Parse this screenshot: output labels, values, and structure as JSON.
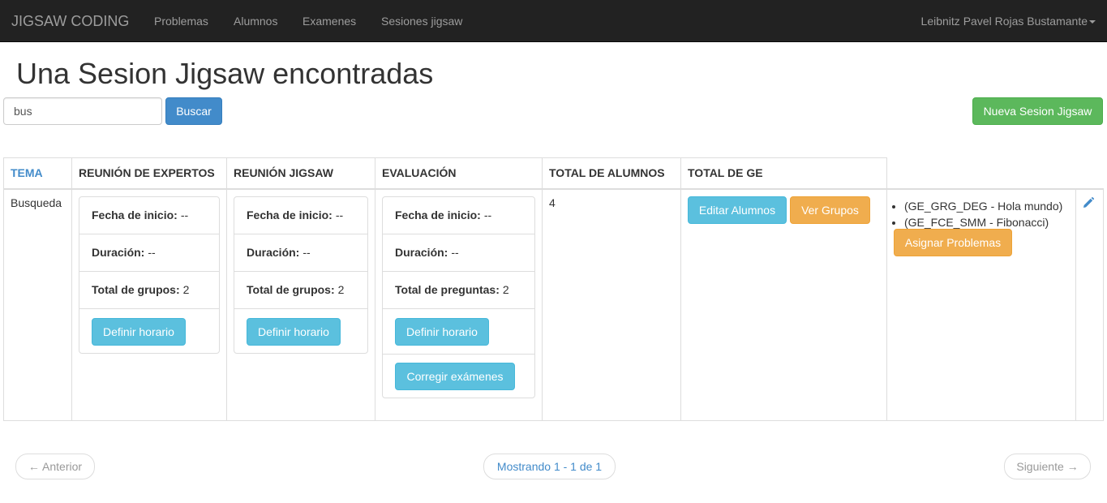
{
  "navbar": {
    "brand": "JIGSAW CODING",
    "links": [
      "Problemas",
      "Alumnos",
      "Examenes",
      "Sesiones jigsaw"
    ],
    "user": "Leibnitz Pavel Rojas Bustamante"
  },
  "page": {
    "title": "Una Sesion Jigsaw encontradas"
  },
  "search": {
    "value": "bus",
    "button": "Buscar"
  },
  "new_button": "Nueva Sesion Jigsaw",
  "table": {
    "headers": [
      "TEMA",
      "REUNIÓN DE EXPERTOS",
      "REUNIÓN JIGSAW",
      "EVALUACIÓN",
      "TOTAL DE ALUMNOS",
      "TOTAL DE GE"
    ],
    "row": {
      "tema": "Busqueda",
      "expertos": {
        "fecha_label": "Fecha de inicio:",
        "fecha_value": "--",
        "duracion_label": "Duración:",
        "duracion_value": "--",
        "grupos_label": "Total de grupos:",
        "grupos_value": "2",
        "button": "Definir horario"
      },
      "jigsaw": {
        "fecha_label": "Fecha de inicio:",
        "fecha_value": "--",
        "duracion_label": "Duración:",
        "duracion_value": "--",
        "grupos_label": "Total de grupos:",
        "grupos_value": "2",
        "button": "Definir horario"
      },
      "evaluacion": {
        "fecha_label": "Fecha de inicio:",
        "fecha_value": "--",
        "duracion_label": "Duración:",
        "duracion_value": "--",
        "preguntas_label": "Total de preguntas:",
        "preguntas_value": "2",
        "button": "Definir horario",
        "button2": "Corregir exámenes"
      },
      "total_alumnos": "4",
      "ge_buttons": {
        "editar": "Editar Alumnos",
        "ver": "Ver Grupos"
      },
      "ge_list": [
        "(GE_GRG_DEG - Hola mundo)",
        "(GE_FCE_SMM - Fibonacci)"
      ],
      "asignar": "Asignar Problemas",
      "edit_icon": "pencil-icon"
    }
  },
  "pager": {
    "prev": "← Anterior",
    "status": "Mostrando 1 - 1 de 1",
    "next": "Siguiente →"
  },
  "colors": {
    "navbar": "#222222",
    "primary": "#428bca",
    "success": "#5cb85c",
    "info": "#5bc0de",
    "warning": "#f0ad4e"
  }
}
